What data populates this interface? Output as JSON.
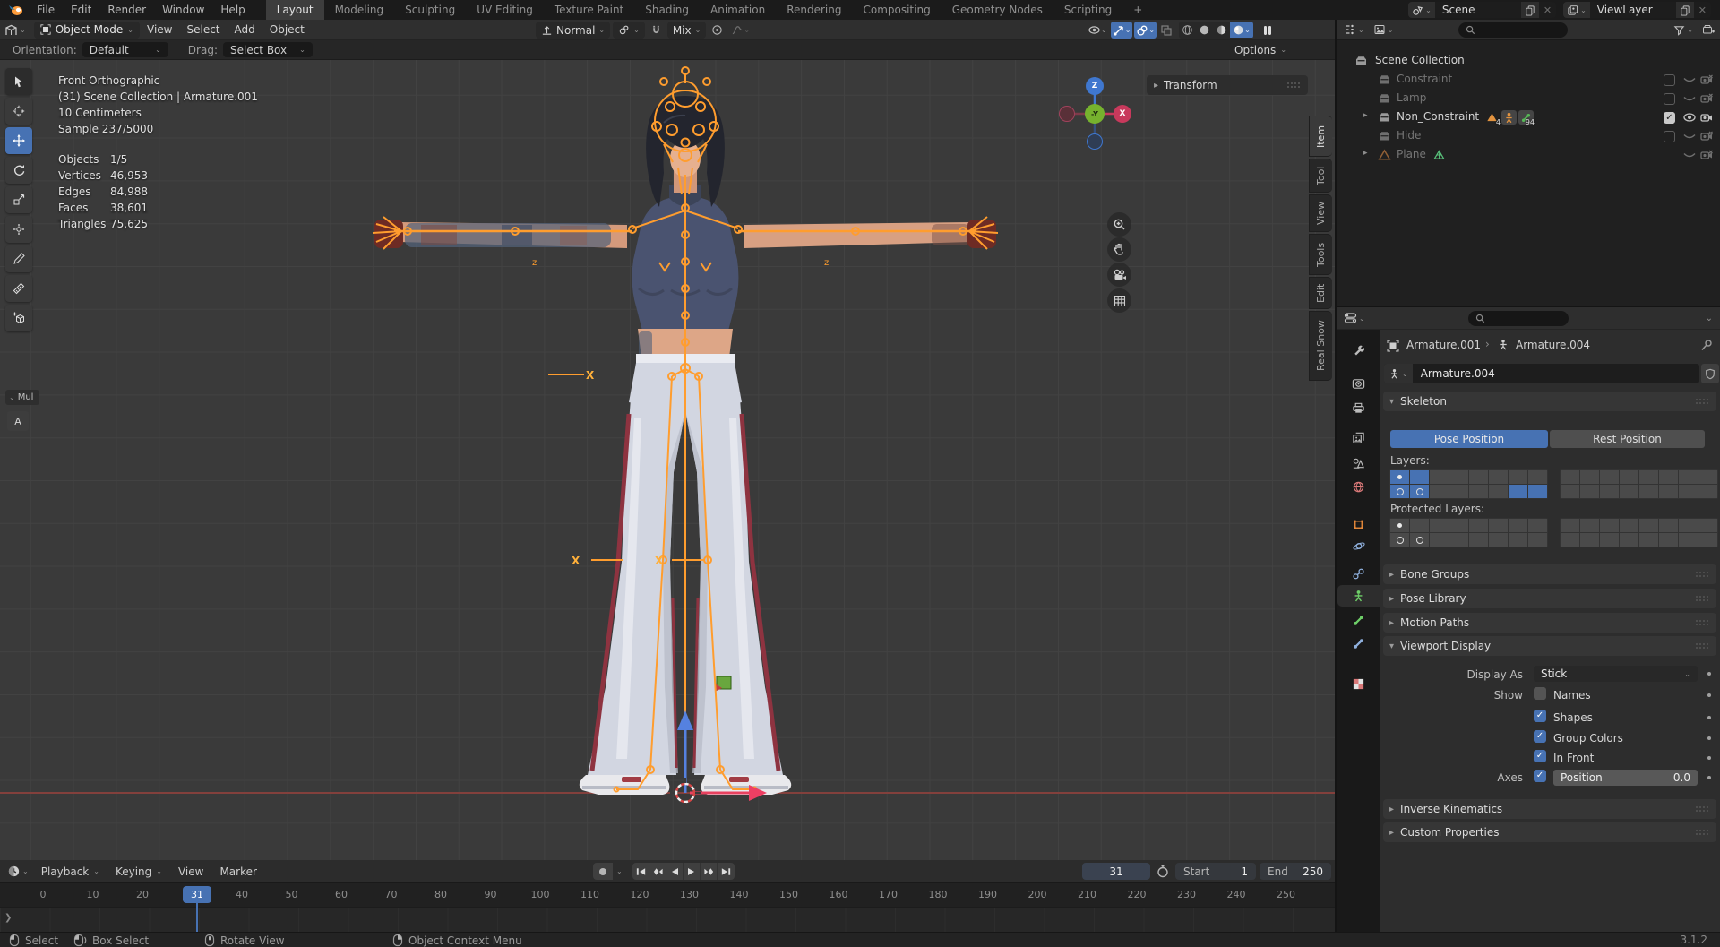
{
  "topbar": {
    "menus": [
      "File",
      "Edit",
      "Render",
      "Window",
      "Help"
    ],
    "workspaces": [
      "Layout",
      "Modeling",
      "Sculpting",
      "UV Editing",
      "Texture Paint",
      "Shading",
      "Animation",
      "Rendering",
      "Compositing",
      "Geometry Nodes",
      "Scripting",
      "+"
    ],
    "active_workspace": 0,
    "scene": {
      "label": "Scene"
    },
    "view_layer": {
      "label": "ViewLayer"
    }
  },
  "viewport_header": {
    "mode": "Object Mode",
    "menus": [
      "View",
      "Select",
      "Add",
      "Object"
    ],
    "orientation": "Normal",
    "proportional_falloff": "Mix"
  },
  "tool_settings": {
    "orientation_label": "Orientation:",
    "orientation_value": "Default",
    "drag_label": "Drag:",
    "drag_value": "Select Box",
    "options_label": "Options"
  },
  "viewport": {
    "info_lines": [
      "Front Orthographic",
      "(31) Scene Collection | Armature.001",
      "10 Centimeters",
      "Sample 237/5000"
    ],
    "stats": [
      [
        "Objects",
        "1/5"
      ],
      [
        "Vertices",
        "46,953"
      ],
      [
        "Edges",
        "84,988"
      ],
      [
        "Faces",
        "38,601"
      ],
      [
        "Triangles",
        "75,625"
      ]
    ],
    "tools": [
      "tweak",
      "cursor",
      "move",
      "rotate",
      "scale",
      "transform",
      "annotate",
      "measure",
      "add-cube"
    ],
    "active_tool_index": 2,
    "left_panel_label": "Mul",
    "annotation_label": "A",
    "gizmo": {
      "up": "Z",
      "right": "X",
      "center": "-Y"
    },
    "transform_panel_label": "Transform",
    "sidebar_tabs": [
      "Item",
      "Tool",
      "View",
      "Tools",
      "Edit",
      "Real Snow"
    ]
  },
  "outliner": {
    "rows": [
      {
        "name": "Scene Collection",
        "icon": "collection",
        "level": 0,
        "controls": "none",
        "dim": false,
        "expand": false
      },
      {
        "name": "Constraint",
        "icon": "collection",
        "level": 1,
        "controls": "disabled",
        "dim": true,
        "expand": false
      },
      {
        "name": "Lamp",
        "icon": "collection",
        "level": 1,
        "controls": "disabled",
        "dim": true,
        "expand": false
      },
      {
        "name": "Non_Constraint",
        "icon": "collection",
        "level": 1,
        "controls": "enabled",
        "dim": false,
        "expand": true,
        "badges": [
          {
            "icon": "mesh",
            "count": "4"
          },
          {
            "icon": "armature",
            "count": ""
          },
          {
            "icon": "bone",
            "count": "94"
          }
        ]
      },
      {
        "name": "Hide",
        "icon": "collection",
        "level": 1,
        "controls": "disabled",
        "dim": true,
        "expand": false
      },
      {
        "name": "Plane",
        "icon": "mesh",
        "level": 1,
        "controls": "disabled-nocheck",
        "dim": true,
        "expand": true,
        "badges": [
          {
            "icon": "modifier",
            "count": ""
          }
        ]
      }
    ]
  },
  "properties": {
    "breadcrumb": {
      "object": "Armature.001",
      "separator": "›",
      "data": "Armature.004"
    },
    "name_field": "Armature.004",
    "skeleton": {
      "title": "Skeleton",
      "pose_position": "Pose Position",
      "rest_position": "Rest Position",
      "pose_active": true,
      "layers_label": "Layers:",
      "protected_label": "Protected Layers:",
      "layers": {
        "cols": 8,
        "top_on": [
          0,
          1
        ],
        "top_dot": [
          0
        ],
        "bottom_on": [
          0,
          1,
          6,
          7
        ],
        "bottom_circle": [
          0,
          1
        ]
      },
      "protected_layers": {
        "cols": 8,
        "top_on": [],
        "top_dot": [
          0
        ],
        "bottom_on": [],
        "bottom_circle": [
          0,
          1
        ]
      }
    },
    "panels": {
      "bone_groups": "Bone Groups",
      "pose_library": "Pose Library",
      "motion_paths": "Motion Paths",
      "viewport_display": "Viewport Display",
      "inverse_kinematics": "Inverse Kinematics",
      "custom_properties": "Custom Properties"
    },
    "viewport_display": {
      "display_as_label": "Display As",
      "display_as_value": "Stick",
      "show_label": "Show",
      "names_label": "Names",
      "names_checked": false,
      "shapes_label": "Shapes",
      "shapes_checked": true,
      "group_colors_label": "Group Colors",
      "group_colors_checked": true,
      "in_front_label": "In Front",
      "in_front_checked": true,
      "axes_label": "Axes",
      "axes_checked": true,
      "position_label": "Position",
      "position_value": "0.0"
    }
  },
  "timeline": {
    "menus": [
      "Playback",
      "Keying",
      "View",
      "Marker"
    ],
    "menus_dropdown": [
      true,
      true,
      false,
      false
    ],
    "current_frame": "31",
    "start_label": "Start",
    "start_value": "1",
    "end_label": "End",
    "end_value": "250",
    "ruler_frames": [
      0,
      10,
      20,
      40,
      50,
      60,
      70,
      80,
      90,
      100,
      110,
      120,
      130,
      140,
      150,
      160,
      170,
      180,
      190,
      200,
      210,
      220,
      230,
      240,
      250
    ]
  },
  "statusbar": {
    "items": [
      {
        "icon": "mouse-left",
        "label": "Select"
      },
      {
        "icon": "mouse-drag",
        "label": "Box Select"
      },
      {
        "icon": "mouse-middle",
        "label": "Rotate View"
      },
      {
        "icon": "mouse-right",
        "label": "Object Context Menu"
      }
    ],
    "version": "3.1.2"
  },
  "colors": {
    "accent": "#4772b3",
    "armature_orange": "#ff9d2e",
    "axis_x_red": "#e8415f",
    "axis_z_blue": "#5581e0",
    "axis_y_green": "#76b22e"
  }
}
